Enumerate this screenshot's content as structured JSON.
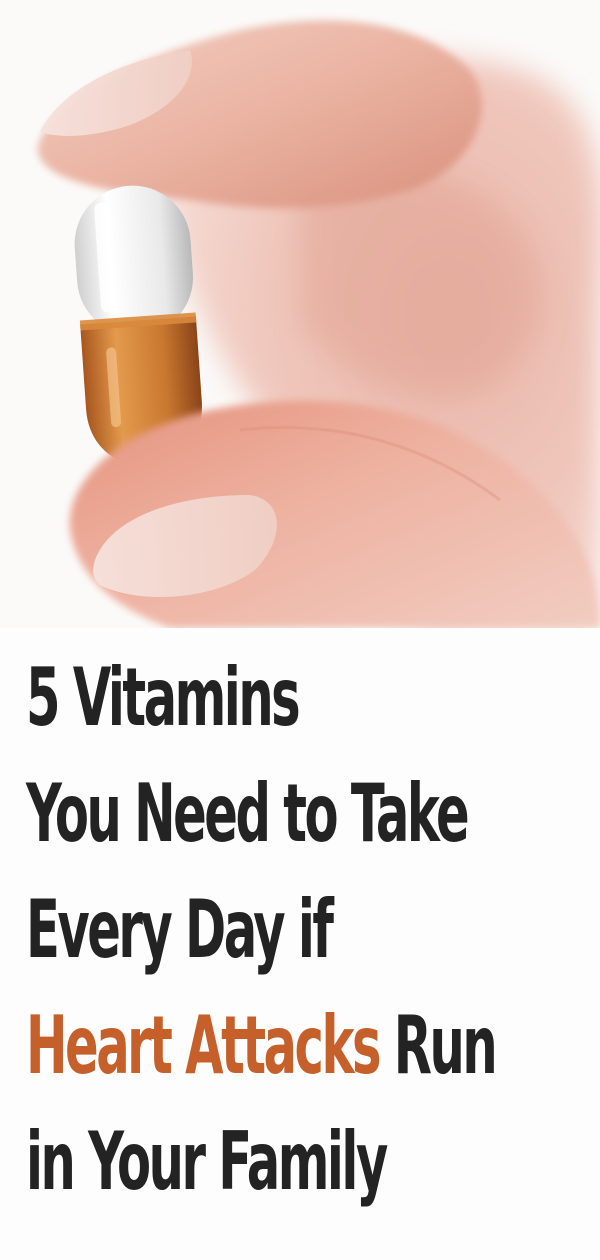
{
  "headline": {
    "line1": "5 Vitamins",
    "line2": "You Need to Take",
    "line3": "Every Day if",
    "line4_accent": "Heart Attacks",
    "line4_rest": " Run",
    "line5": "in Your Family"
  },
  "colors": {
    "text": "#232323",
    "accent": "#c5602a",
    "background": "#fdfdfd"
  },
  "photo": {
    "subject": "fingers holding a white and orange vitamin capsule"
  }
}
